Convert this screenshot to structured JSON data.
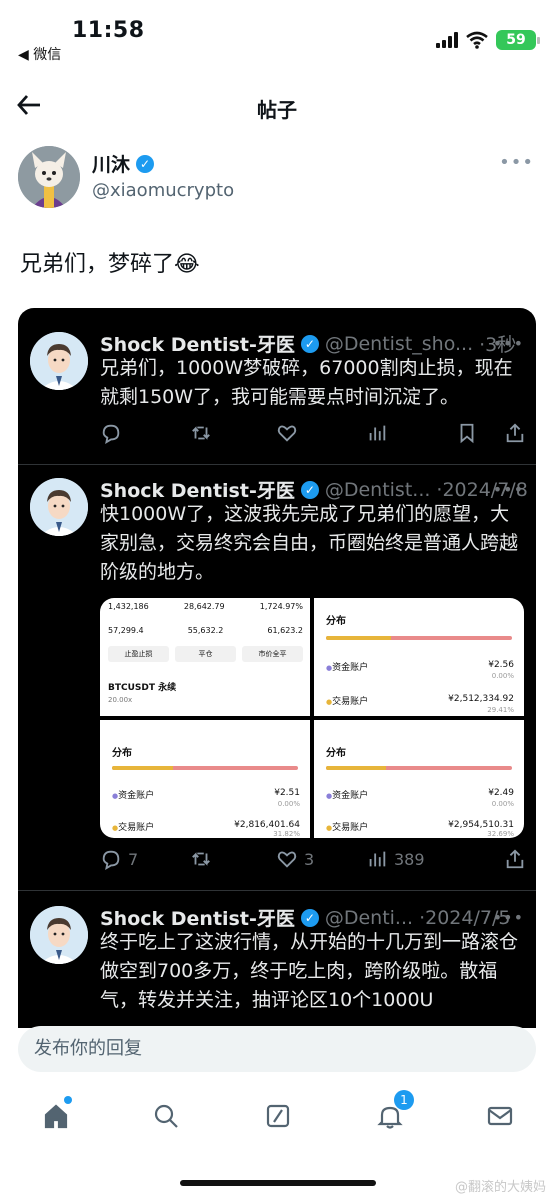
{
  "status": {
    "time": "11:58",
    "back_app": "◀ 微信",
    "battery": "59"
  },
  "header": {
    "title": "帖子"
  },
  "author": {
    "name": "川沐",
    "handle": "@xiaomucrypto"
  },
  "post": {
    "text": "兄弟们，梦碎了😂"
  },
  "embedded": {
    "tweets": [
      {
        "name": "Shock Dentist-牙医",
        "handle": "@Dentist_sho...",
        "time": "·3秒",
        "body": "兄弟们，1000W梦破碎，67000割肉止损，现在就剩150W了，我可能需要点时间沉淀了。"
      },
      {
        "name": "Shock Dentist-牙医",
        "handle": "@Dentist...",
        "time": "·2024/7/8",
        "body": "快1000W了，这波我先完成了兄弟们的愿望，大家别急，交易终究会自由，币圈始终是普通人跨越阶级的地方。",
        "stats": {
          "replies": "7",
          "likes": "3",
          "views": "389"
        }
      },
      {
        "name": "Shock Dentist-牙医",
        "handle": "@Denti...",
        "time": "·2024/7/5",
        "body": "终于吃上了这波行情，从开始的十几万到一路滚仓做空到700多万，终于吃上肉，跨阶级啦。散福气，转发并关注，抽评论区10个1000U"
      }
    ],
    "trade_tile": {
      "r1": [
        "1,432,186",
        "28,642.79",
        "1,724.97%"
      ],
      "r2": [
        "57,299.4",
        "55,632.2",
        "61,623.2"
      ],
      "buttons": [
        "止盈止损",
        "平仓",
        "市价全平"
      ],
      "pair": "BTCUSDT 永续",
      "tag": "20.00x"
    },
    "dist_tiles": [
      {
        "title": "分布",
        "fund_label": "资金账户",
        "fund": "¥2.56",
        "fund_pct": "0.00%",
        "trade_label": "交易账户",
        "trade": "¥2,512,334.92",
        "trade_pct": "29.41%",
        "fill": 0.35
      },
      {
        "title": "分布",
        "fund_label": "资金账户",
        "fund": "¥2.51",
        "fund_pct": "0.00%",
        "trade_label": "交易账户",
        "trade": "¥2,816,401.64",
        "trade_pct": "31.82%",
        "fill": 0.33
      },
      {
        "title": "分布",
        "fund_label": "资金账户",
        "fund": "¥2.49",
        "fund_pct": "0.00%",
        "trade_label": "交易账户",
        "trade": "¥2,954,510.31",
        "trade_pct": "32.69%",
        "fill": 0.32
      }
    ]
  },
  "reply": {
    "placeholder": "发布你的回复"
  },
  "nav": {
    "notifications_badge": "1"
  },
  "watermark": "@翻滚的大姨妈",
  "colors": {
    "accent": "#1d9bf0",
    "battery": "#34c759",
    "dark_bg": "#000000"
  }
}
